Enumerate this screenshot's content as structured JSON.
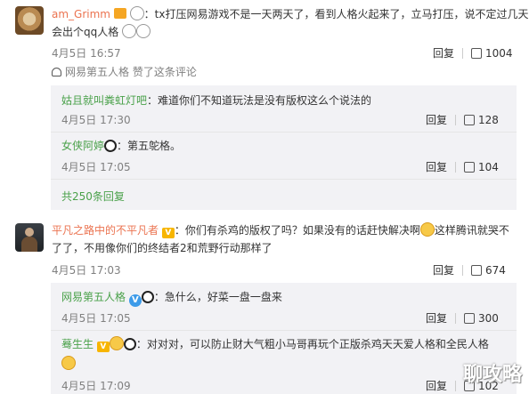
{
  "comment1": {
    "username": "am_Grimm",
    "text1": "：tx打压网易游戏不是一天两天了，看到人格火起来了，立马打压，说不定过几天就",
    "text2": "会出个qq人格",
    "time": "4月5日 16:57",
    "reply_label": "回复",
    "likes": "1004",
    "liked_by": "网易第五人格 赞了这条评论"
  },
  "reply1": {
    "username": "姑且就叫粪虹灯吧",
    "text": "：难道你们不知道玩法是没有版权这么个说法的",
    "time": "4月5日 17:30",
    "reply_label": "回复",
    "likes": "128"
  },
  "reply2": {
    "username": "女侠阿婷",
    "text": "：第五鸵格。",
    "time": "4月5日 17:05",
    "reply_label": "回复",
    "likes": "104"
  },
  "more_replies": "共250条回复",
  "comment2": {
    "username": "平凡之路中的不平凡者",
    "text1": "：你们有杀鸡的版权了吗？如果没有的话赶快解决啊",
    "text1b": "这样腾讯就哭不",
    "text2": "了了，不用像你们的终结者2和荒野行动那样了",
    "time": "4月5日 17:03",
    "reply_label": "回复",
    "likes": "674"
  },
  "reply3": {
    "username": "网易第五人格",
    "text": "：急什么，好菜一盘一盘来",
    "time": "4月5日 17:05",
    "reply_label": "回复",
    "likes": "300"
  },
  "reply4": {
    "username": "蓦生生",
    "text": "：对对对，可以防止财大气粗小马哥再玩个正版杀鸡天天爱人格和全民人格",
    "time": "4月5日 17:09",
    "reply_label": "回复",
    "likes": "102"
  },
  "watermark": "聊攻略"
}
